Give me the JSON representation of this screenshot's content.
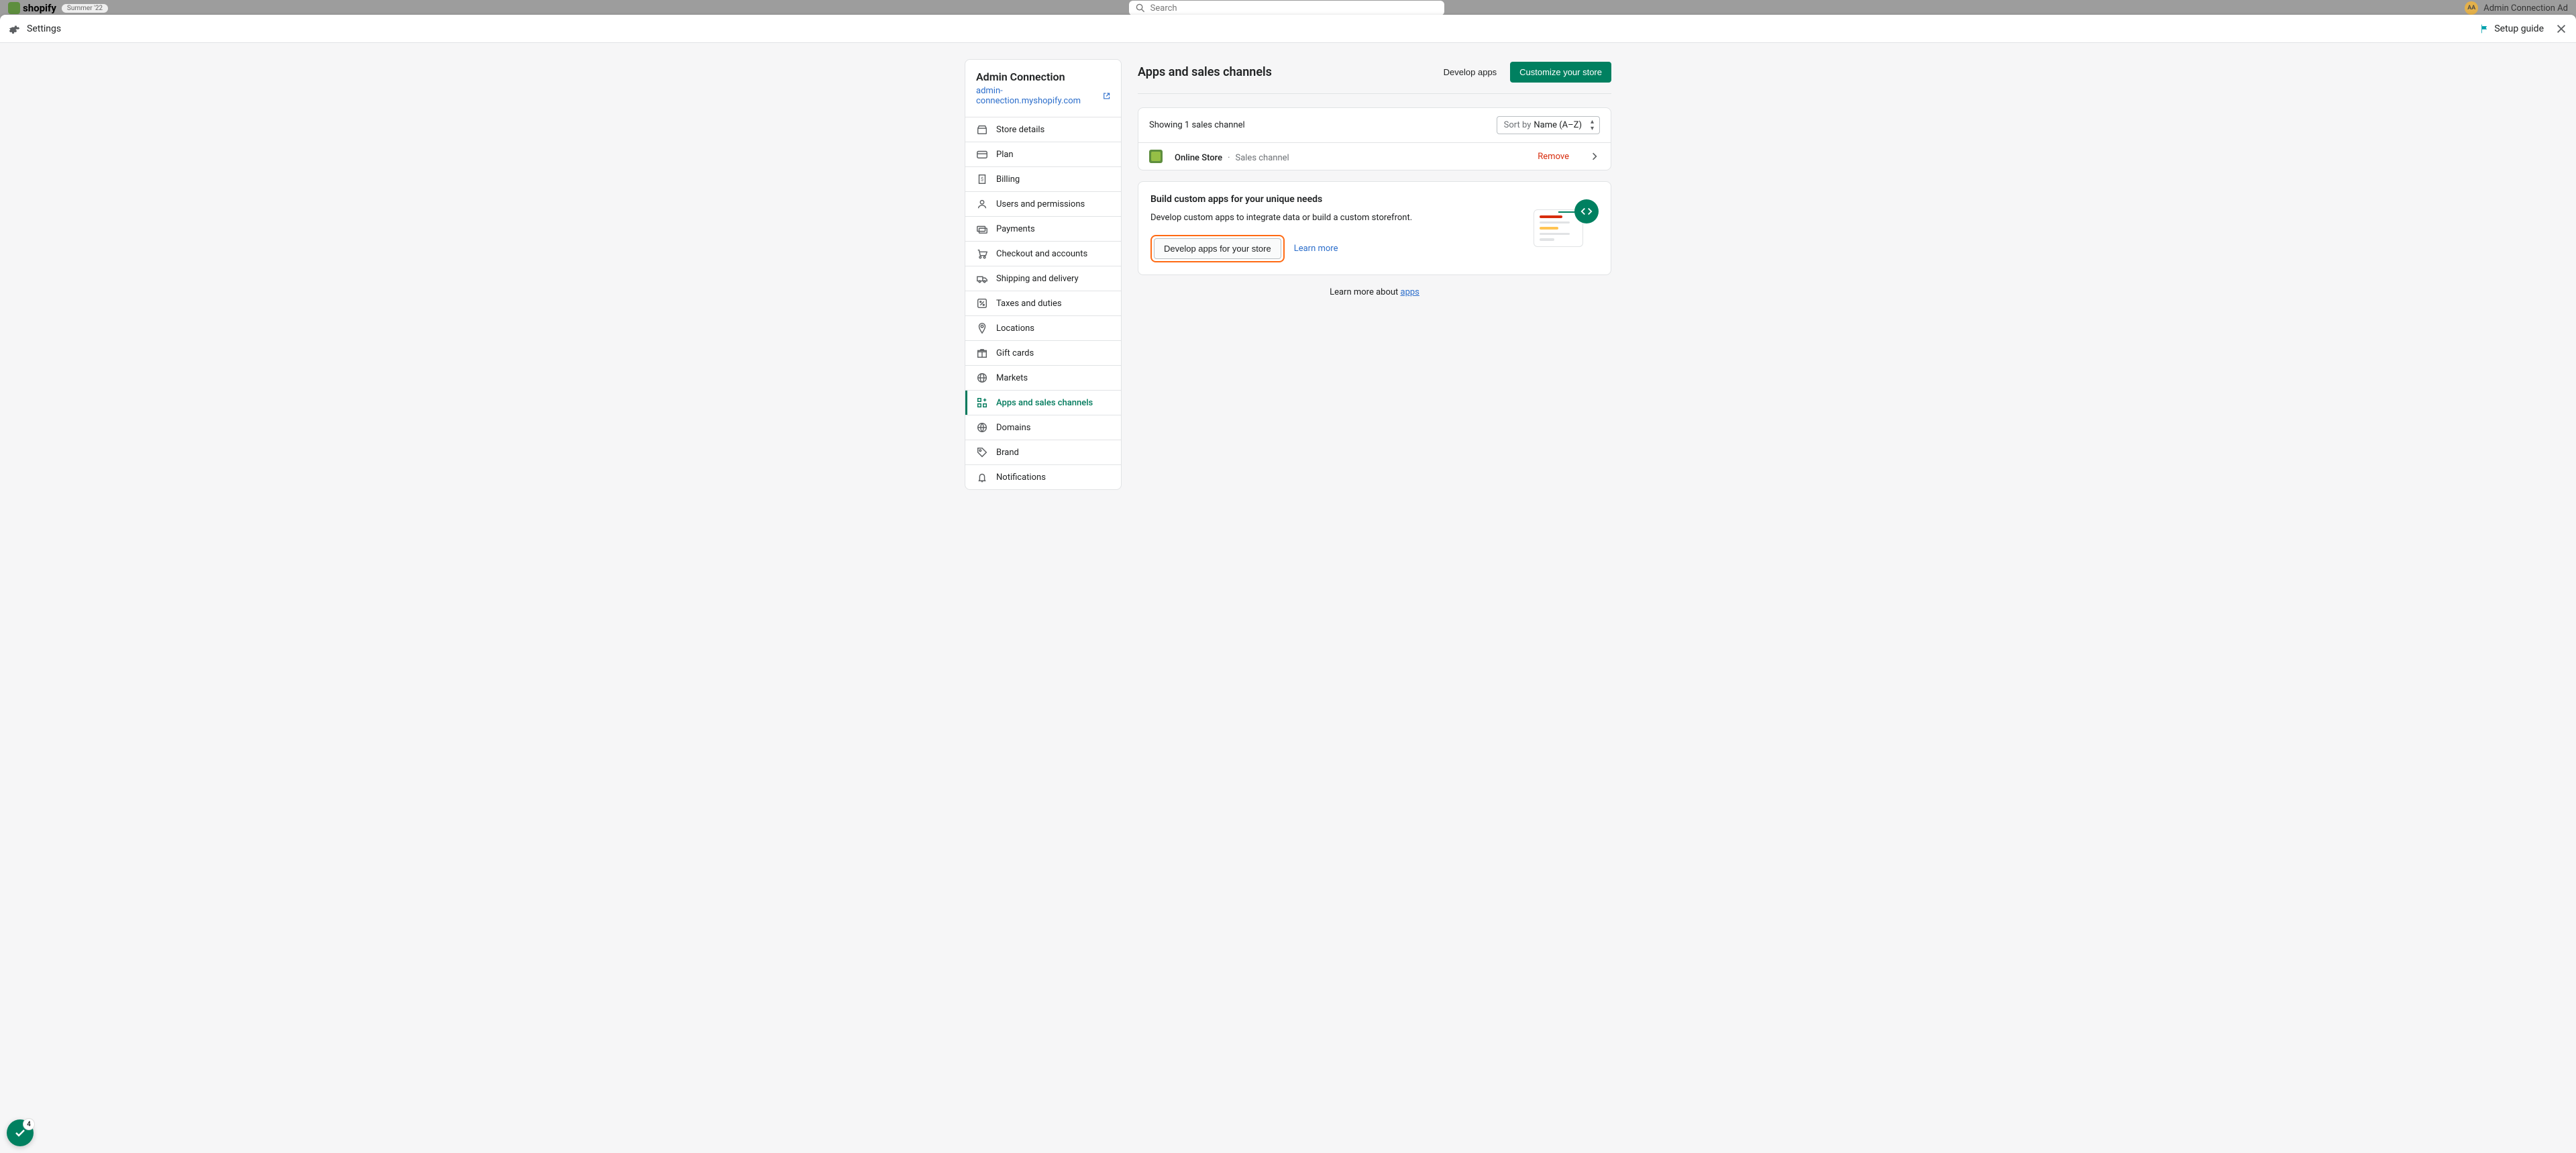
{
  "backdrop": {
    "logo_text": "shopify",
    "pill": "Summer '22",
    "search_placeholder": "Search",
    "user_initials": "AA",
    "user_name": "Admin Connection Ad"
  },
  "header": {
    "title": "Settings",
    "setup_guide": "Setup guide"
  },
  "sidebar": {
    "store_name": "Admin Connection",
    "store_url": "admin-connection.myshopify.com",
    "items": [
      {
        "label": "Store details",
        "icon": "storefront",
        "active": false
      },
      {
        "label": "Plan",
        "icon": "card",
        "active": false
      },
      {
        "label": "Billing",
        "icon": "receipt",
        "active": false
      },
      {
        "label": "Users and permissions",
        "icon": "user",
        "active": false
      },
      {
        "label": "Payments",
        "icon": "payments",
        "active": false
      },
      {
        "label": "Checkout and accounts",
        "icon": "cart",
        "active": false
      },
      {
        "label": "Shipping and delivery",
        "icon": "truck",
        "active": false
      },
      {
        "label": "Taxes and duties",
        "icon": "percent",
        "active": false
      },
      {
        "label": "Locations",
        "icon": "pin",
        "active": false
      },
      {
        "label": "Gift cards",
        "icon": "gift",
        "active": false
      },
      {
        "label": "Markets",
        "icon": "globe",
        "active": false
      },
      {
        "label": "Apps and sales channels",
        "icon": "grid-plus",
        "active": true
      },
      {
        "label": "Domains",
        "icon": "globe-alt",
        "active": false
      },
      {
        "label": "Brand",
        "icon": "tag",
        "active": false
      },
      {
        "label": "Notifications",
        "icon": "bell",
        "active": false
      }
    ]
  },
  "main": {
    "title": "Apps and sales channels",
    "develop_apps": "Develop apps",
    "customize_store": "Customize your store",
    "channels_count": "Showing 1 sales channel",
    "sort_prefix": "Sort by",
    "sort_value": "Name (A–Z)",
    "channel_name": "Online Store",
    "channel_sep": "·",
    "channel_type": "Sales channel",
    "remove": "Remove",
    "build_title": "Build custom apps for your unique needs",
    "build_desc": "Develop custom apps to integrate data or build a custom storefront.",
    "develop_apps_btn": "Develop apps for your store",
    "learn_more": "Learn more",
    "footer_prefix": "Learn more about ",
    "footer_link": "apps"
  },
  "fab_badge": "4"
}
